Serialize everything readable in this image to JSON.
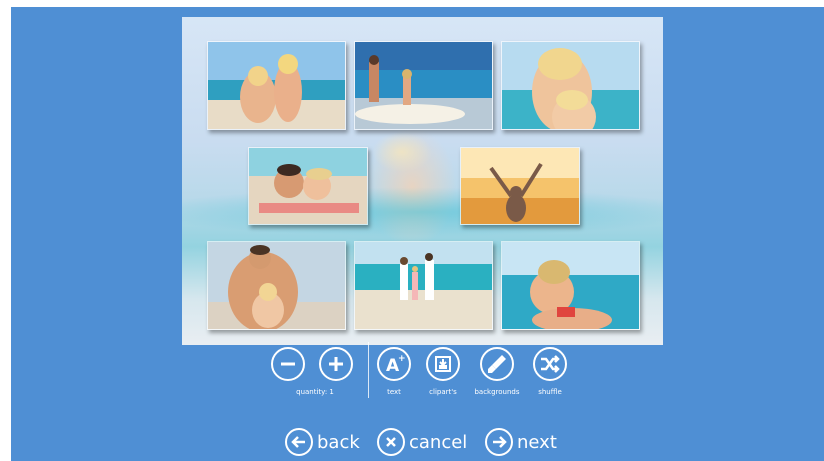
{
  "toolbar": {
    "quantity_label": "quantity: 1",
    "text_label": "text",
    "cliparts_label": "clipart's",
    "backgrounds_label": "backgrounds",
    "shuffle_label": "shuffle"
  },
  "nav": {
    "back_label": "back",
    "cancel_label": "cancel",
    "next_label": "next"
  },
  "icons": {
    "minus": "minus-icon",
    "plus": "plus-icon",
    "text": "text-add-icon",
    "clipart": "clipart-icon",
    "backgrounds": "brush-icon",
    "shuffle": "shuffle-icon",
    "back": "arrow-left-icon",
    "cancel": "close-icon",
    "next": "arrow-right-icon"
  },
  "colors": {
    "app_background": "#4f8fd4",
    "icon_stroke": "#ffffff"
  }
}
